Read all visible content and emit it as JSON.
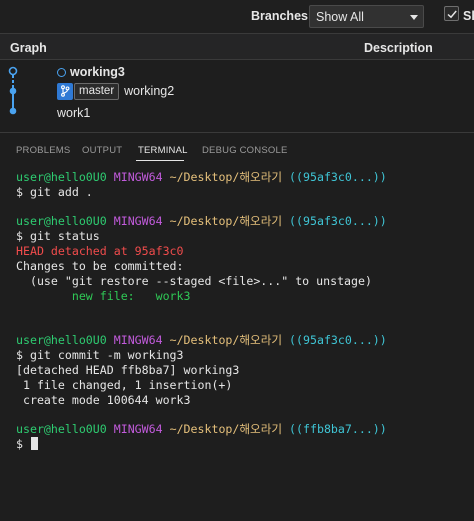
{
  "toolbar": {
    "branches_label": "Branches:",
    "branch_select_value": "Show All",
    "show_label": "Sh",
    "show_checked": true
  },
  "graph_header": {
    "graph_label": "Graph",
    "description_label": "Description"
  },
  "commits": [
    {
      "message": "working3",
      "is_head": true
    },
    {
      "branch": "master",
      "message": "working2"
    },
    {
      "message": "work1"
    }
  ],
  "panel_tabs": [
    "PROBLEMS",
    "OUTPUT",
    "TERMINAL",
    "DEBUG CONSOLE"
  ],
  "active_tab": "TERMINAL",
  "terminal": {
    "prompts": [
      {
        "user_host": "user@hello0U0",
        "shell": "MINGW64",
        "path": "~/Desktop/해오라기",
        "ref": "((95af3c0...))"
      },
      {
        "user_host": "user@hello0U0",
        "shell": "MINGW64",
        "path": "~/Desktop/해오라기",
        "ref": "((95af3c0...))"
      },
      {
        "user_host": "user@hello0U0",
        "shell": "MINGW64",
        "path": "~/Desktop/해오라기",
        "ref": "((95af3c0...))"
      },
      {
        "user_host": "user@hello0U0",
        "shell": "MINGW64",
        "path": "~/Desktop/해오라기",
        "ref": "((ffb8ba7...))"
      }
    ],
    "commands": [
      "$ git add .",
      "$ git status",
      "$ git commit -m working3",
      "$ "
    ],
    "status_output": {
      "head_detached": "HEAD detached at 95af3c0",
      "changes_header": "Changes to be committed:",
      "hint": "  (use \"git restore --staged <file>...\" to unstage)",
      "new_file": "        new file:   work3"
    },
    "commit_output": [
      "[detached HEAD ffb8ba7] working3",
      " 1 file changed, 1 insertion(+)",
      " create mode 100644 work3"
    ]
  },
  "colors": {
    "terminal_green": "#2ecc71",
    "terminal_magenta": "#c25bdc",
    "terminal_yellow": "#e5c07b",
    "terminal_cyan": "#3fc5d5",
    "terminal_red": "#f14c4c",
    "graph_blue": "#4aa3f0",
    "branch_badge_blue": "#2f79d4"
  }
}
